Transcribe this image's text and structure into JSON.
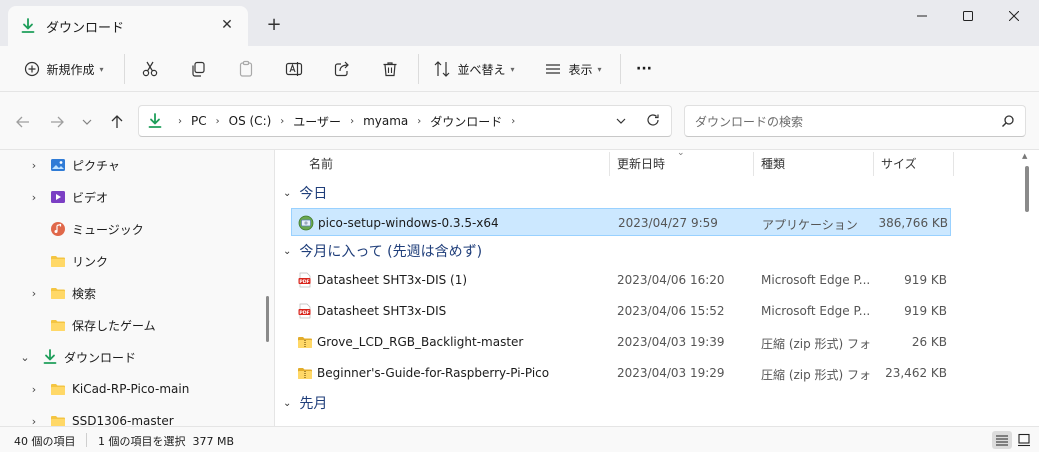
{
  "window": {
    "tab_title": "ダウンロード",
    "tab_close": "✕",
    "new_tab": "+"
  },
  "toolbar": {
    "new_label": "新規作成",
    "sort_label": "並べ替え",
    "view_label": "表示",
    "more_label": "···"
  },
  "address": {
    "crumbs": [
      "PC",
      "OS (C:)",
      "ユーザー",
      "myama",
      "ダウンロード"
    ],
    "search_placeholder": "ダウンロードの検索"
  },
  "nav": {
    "items": [
      {
        "label": "ピクチャ",
        "icon": "pictures-icon",
        "expandable": true
      },
      {
        "label": "ビデオ",
        "icon": "videos-icon",
        "expandable": true
      },
      {
        "label": "ミュージック",
        "icon": "music-icon",
        "expandable": false
      },
      {
        "label": "リンク",
        "icon": "folder-icon",
        "expandable": false
      },
      {
        "label": "検索",
        "icon": "folder-icon",
        "expandable": true
      },
      {
        "label": "保存したゲーム",
        "icon": "folder-icon",
        "expandable": false
      },
      {
        "label": "ダウンロード",
        "icon": "download-icon",
        "expandable": true,
        "expanded": true
      },
      {
        "label": "KiCad-RP-Pico-main",
        "icon": "folder-icon",
        "expandable": true
      },
      {
        "label": "SSD1306-master",
        "icon": "folder-icon",
        "expandable": true
      }
    ]
  },
  "columns": {
    "name": "名前",
    "date": "更新日時",
    "type": "種類",
    "size": "サイズ"
  },
  "groups": {
    "today": "今日",
    "this_month": "今月に入って (先週は含めず)",
    "last_month": "先月"
  },
  "files": {
    "today": [
      {
        "name": "pico-setup-windows-0.3.5-x64",
        "date": "2023/04/27 9:59",
        "type": "アプリケーション",
        "size": "386,766 KB",
        "icon": "setup-app-icon",
        "selected": true
      }
    ],
    "this_month": [
      {
        "name": "Datasheet SHT3x-DIS (1)",
        "date": "2023/04/06 16:20",
        "type": "Microsoft Edge P...",
        "size": "919 KB",
        "icon": "pdf-icon"
      },
      {
        "name": "Datasheet SHT3x-DIS",
        "date": "2023/04/06 15:52",
        "type": "Microsoft Edge P...",
        "size": "919 KB",
        "icon": "pdf-icon"
      },
      {
        "name": "Grove_LCD_RGB_Backlight-master",
        "date": "2023/04/03 19:39",
        "type": "圧縮 (zip 形式) フォ...",
        "size": "26 KB",
        "icon": "zip-folder-icon"
      },
      {
        "name": "Beginner's-Guide-for-Raspberry-Pi-Pico",
        "date": "2023/04/03 19:29",
        "type": "圧縮 (zip 形式) フォ...",
        "size": "23,462 KB",
        "icon": "zip-folder-icon"
      }
    ]
  },
  "status": {
    "count": "40 個の項目",
    "selection": "1 個の項目を選択  377 MB"
  },
  "colors": {
    "accent": "#0067c0",
    "selection": "#cce8ff",
    "folder": "#f4c542",
    "download_green": "#1e9e5a",
    "pdf_red": "#d9251c"
  }
}
